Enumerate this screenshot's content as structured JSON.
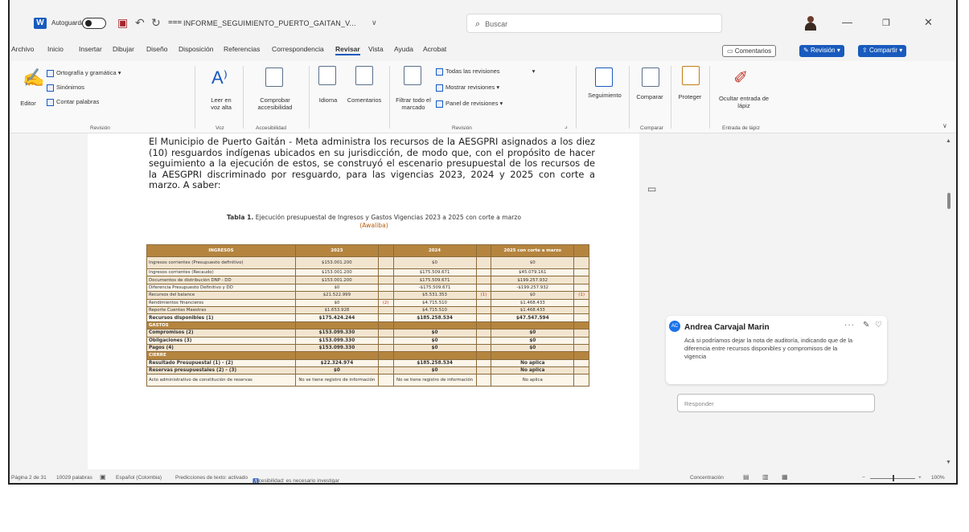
{
  "titlebar": {
    "autosave": "Autoguardado",
    "doc_title": "INFORME_SEGUIMIENTO_PUERTO_GAITAN_V...",
    "search_placeholder": "Buscar"
  },
  "menu": {
    "tabs": [
      "Archivo",
      "Inicio",
      "Insertar",
      "Dibujar",
      "Diseño",
      "Disposición",
      "Referencias",
      "Correspondencia",
      "Revisar",
      "Vista",
      "Ayuda",
      "Acrobat"
    ],
    "active": "Revisar",
    "comentarios_btn": "Comentarios",
    "revision_btn": "Revisión",
    "compartir_btn": "Compartir"
  },
  "ribbon": {
    "editor": "Editor",
    "ortografia": "Ortografía y gramática",
    "sinonimos": "Sinónimos",
    "contar": "Contar palabras",
    "grp_revision": "Revisión",
    "leer": "Leer en voz alta",
    "grp_voz": "Voz",
    "comprobar": "Comprobar accesibilidad",
    "grp_acc": "Accesibilidad",
    "idioma": "Idioma",
    "comentarios": "Comentarios",
    "filtrar": "Filtrar todo el marcado",
    "todas_rev": "Todas las revisiones",
    "mostrar_rev": "Mostrar revisiones",
    "panel_rev": "Panel de revisiones",
    "grp_seguimiento": "Revisión",
    "seguimiento": "Seguimiento",
    "comparar": "Comparar",
    "grp_comparar": "Comparar",
    "proteger": "Proteger",
    "ocultar": "Ocultar entrada de lápiz",
    "grp_lapiz": "Entrada de lápiz"
  },
  "document": {
    "paragraph": "El Municipio de Puerto Gaitán - Meta administra los recursos de la AESGPRI asignados a los diez (10) resguardos indígenas ubicados en su jurisdicción, de modo que, con el propósito de hacer seguimiento a la ejecución de estos, se construyó el escenario presupuestal de los recursos de la AESGPRI discriminado por resguardo, para las vigencias 2023, 2024 y 2025 con corte a marzo. A saber:",
    "caption_bold": "Tabla 1.",
    "caption_text": "Ejecución presupuestal de Ingresos y Gastos Vigencias 2023 a 2025 con corte a marzo",
    "caption_hl": "(Awaliba)"
  },
  "table": {
    "headers": [
      "INGRESOS",
      "2023",
      "",
      "2024",
      "",
      "2025 con corte a marzo",
      ""
    ],
    "rows": [
      {
        "style": "beige tall",
        "cells": [
          "Ingresos corrientes (Presupuesto definitivo)",
          "$153.001.200",
          "",
          "$0",
          "",
          "$0",
          ""
        ]
      },
      {
        "style": "plain",
        "cells": [
          "Ingresos corrientes (Recaudo)",
          "$153.001.200",
          "",
          "$175.509.671",
          "",
          "$45.079.161",
          ""
        ]
      },
      {
        "style": "beige",
        "cells": [
          "Documentos de distribución DNP - DD",
          "$153.001.200",
          "",
          "$175.509.671",
          "",
          "$199.257.932",
          ""
        ]
      },
      {
        "style": "plain",
        "cells": [
          "Diferencia Presupuesto Definitivo y DD",
          "$0",
          "",
          "-$175.509.671",
          "",
          "-$199.257.932",
          ""
        ]
      },
      {
        "style": "beige",
        "cells": [
          "Recursos del balance",
          "$21.522.999",
          "",
          "$5.531.353",
          "(1)",
          "$0",
          "(1)"
        ]
      },
      {
        "style": "plain",
        "cells": [
          "Rendimientos financieros",
          "$0",
          "(2)",
          "$4.715.510",
          "",
          "$1.468.433",
          ""
        ]
      },
      {
        "style": "beige",
        "cells": [
          "Reporte Cuentas Maestras",
          "$1.653.928",
          "",
          "$4.715.510",
          "",
          "$1.468.433",
          ""
        ]
      },
      {
        "style": "plain bold",
        "cells": [
          "Recursos disponibles (1)",
          "$175.424.244",
          "",
          "$185.258.534",
          "",
          "$47.547.594",
          ""
        ]
      },
      {
        "style": "section",
        "cells": [
          "GASTOS",
          "",
          "",
          "",
          "",
          "",
          ""
        ]
      },
      {
        "style": "beige bold",
        "cells": [
          "Compromisos (2)",
          "$153.099.330",
          "",
          "$0",
          "",
          "$0",
          ""
        ]
      },
      {
        "style": "plain bold",
        "cells": [
          "Obligaciones (3)",
          "$153.099.330",
          "",
          "$0",
          "",
          "$0",
          ""
        ]
      },
      {
        "style": "beige bold",
        "cells": [
          "Pagos (4)",
          "$153.099.330",
          "",
          "$0",
          "",
          "$0",
          ""
        ]
      },
      {
        "style": "section",
        "cells": [
          "CIERRE",
          "",
          "",
          "",
          "",
          "",
          ""
        ]
      },
      {
        "style": "plain bold",
        "cells": [
          "Resultado Presupuestal (1) - (2)",
          "$22.324.974",
          "",
          "$185.258.534",
          "",
          "No aplica",
          ""
        ]
      },
      {
        "style": "beige bold",
        "cells": [
          "Reservas presupuestales (2) - (3)",
          "$0",
          "",
          "$0",
          "",
          "No aplica",
          ""
        ]
      },
      {
        "style": "plain tall",
        "cells": [
          "Acto administrativo de constitución de reservas",
          "No se tiene registro de información",
          "",
          "No se tiene registro de información",
          "",
          "No aplica",
          ""
        ]
      }
    ]
  },
  "comment": {
    "initials": "AC",
    "author": "Andrea Carvajal Marin",
    "text": "Acá si podríamos dejar la nota de auditoría, indicando que de la diferencia entre recursos disponibles y compromisos de la vigencia",
    "reply_placeholder": "Responder"
  },
  "statusbar": {
    "page": "Página 2 de 31",
    "words": "10029 palabras",
    "language": "Español (Colombia)",
    "predictions": "Predicciones de texto: activado",
    "accessibility": "Accesibilidad: es necesario investigar",
    "focus": "Concentración",
    "zoom": "100%"
  }
}
